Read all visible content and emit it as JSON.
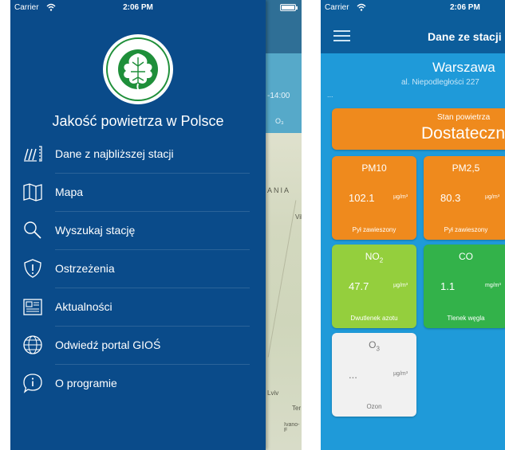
{
  "left_screen": {
    "status_bar": {
      "carrier": "Carrier",
      "time": "2:06 PM"
    },
    "logo_text": "INSPEKCJA OCHRONY ŚRODOWISKA",
    "app_title": "Jakość powietrza w Polsce",
    "menu_items": [
      {
        "label": "Dane z najbliższej stacji",
        "icon": "measurement-icon"
      },
      {
        "label": "Mapa",
        "icon": "map-icon"
      },
      {
        "label": "Wyszukaj stację",
        "icon": "search-icon"
      },
      {
        "label": "Ostrzeżenia",
        "icon": "warning-shield-icon"
      },
      {
        "label": "Aktualności",
        "icon": "news-icon"
      },
      {
        "label": "Odwiedź portal GIOŚ",
        "icon": "globe-www-icon"
      },
      {
        "label": "O programie",
        "icon": "info-icon"
      }
    ],
    "peek": {
      "time": "-14:00",
      "o3": "O₃",
      "map_labels": [
        "ANIA",
        "Vil",
        "Lviv",
        "Ter",
        "Ivano-F"
      ]
    }
  },
  "right_screen": {
    "status_bar": {
      "carrier": "Carrier",
      "time": "2:06 PM"
    },
    "nav_title": "Dane ze stacji",
    "station": {
      "city": "Warszawa",
      "address": "al. Niepodległości 227",
      "timestamp": "..."
    },
    "overall": {
      "caption": "Stan powietrza",
      "value": "Dostateczny"
    },
    "tiles": [
      {
        "name": "PM10",
        "sub": "",
        "value": "102.1",
        "unit": "µg/m³",
        "desc": "Pył zawieszony",
        "color": "#ef8a1d"
      },
      {
        "name": "PM2,5",
        "sub": "",
        "value": "80.3",
        "unit": "µg/m³",
        "desc": "Pył zawieszony",
        "color": "#ef8a1d"
      },
      {
        "name": "NO",
        "sub": "2",
        "value": "47.7",
        "unit": "µg/m³",
        "desc": "Dwutlenek azotu",
        "color": "#94cf3d"
      },
      {
        "name": "CO",
        "sub": "",
        "value": "1.1",
        "unit": "mg/m³",
        "desc": "Tlenek węgla",
        "color": "#33b24a"
      },
      {
        "name": "O",
        "sub": "3",
        "value": "...",
        "unit": "µg/m³",
        "desc": "Ozon",
        "color": "#f1f1f1"
      }
    ]
  },
  "colors": {
    "drawer_bg": "#0a4b8a",
    "nav_bg": "#0c5d9b",
    "screen_bg": "#1f9ad9",
    "moderate": "#ef8a1d",
    "fair": "#94cf3d",
    "good": "#33b24a",
    "no_data": "#f1f1f1"
  }
}
